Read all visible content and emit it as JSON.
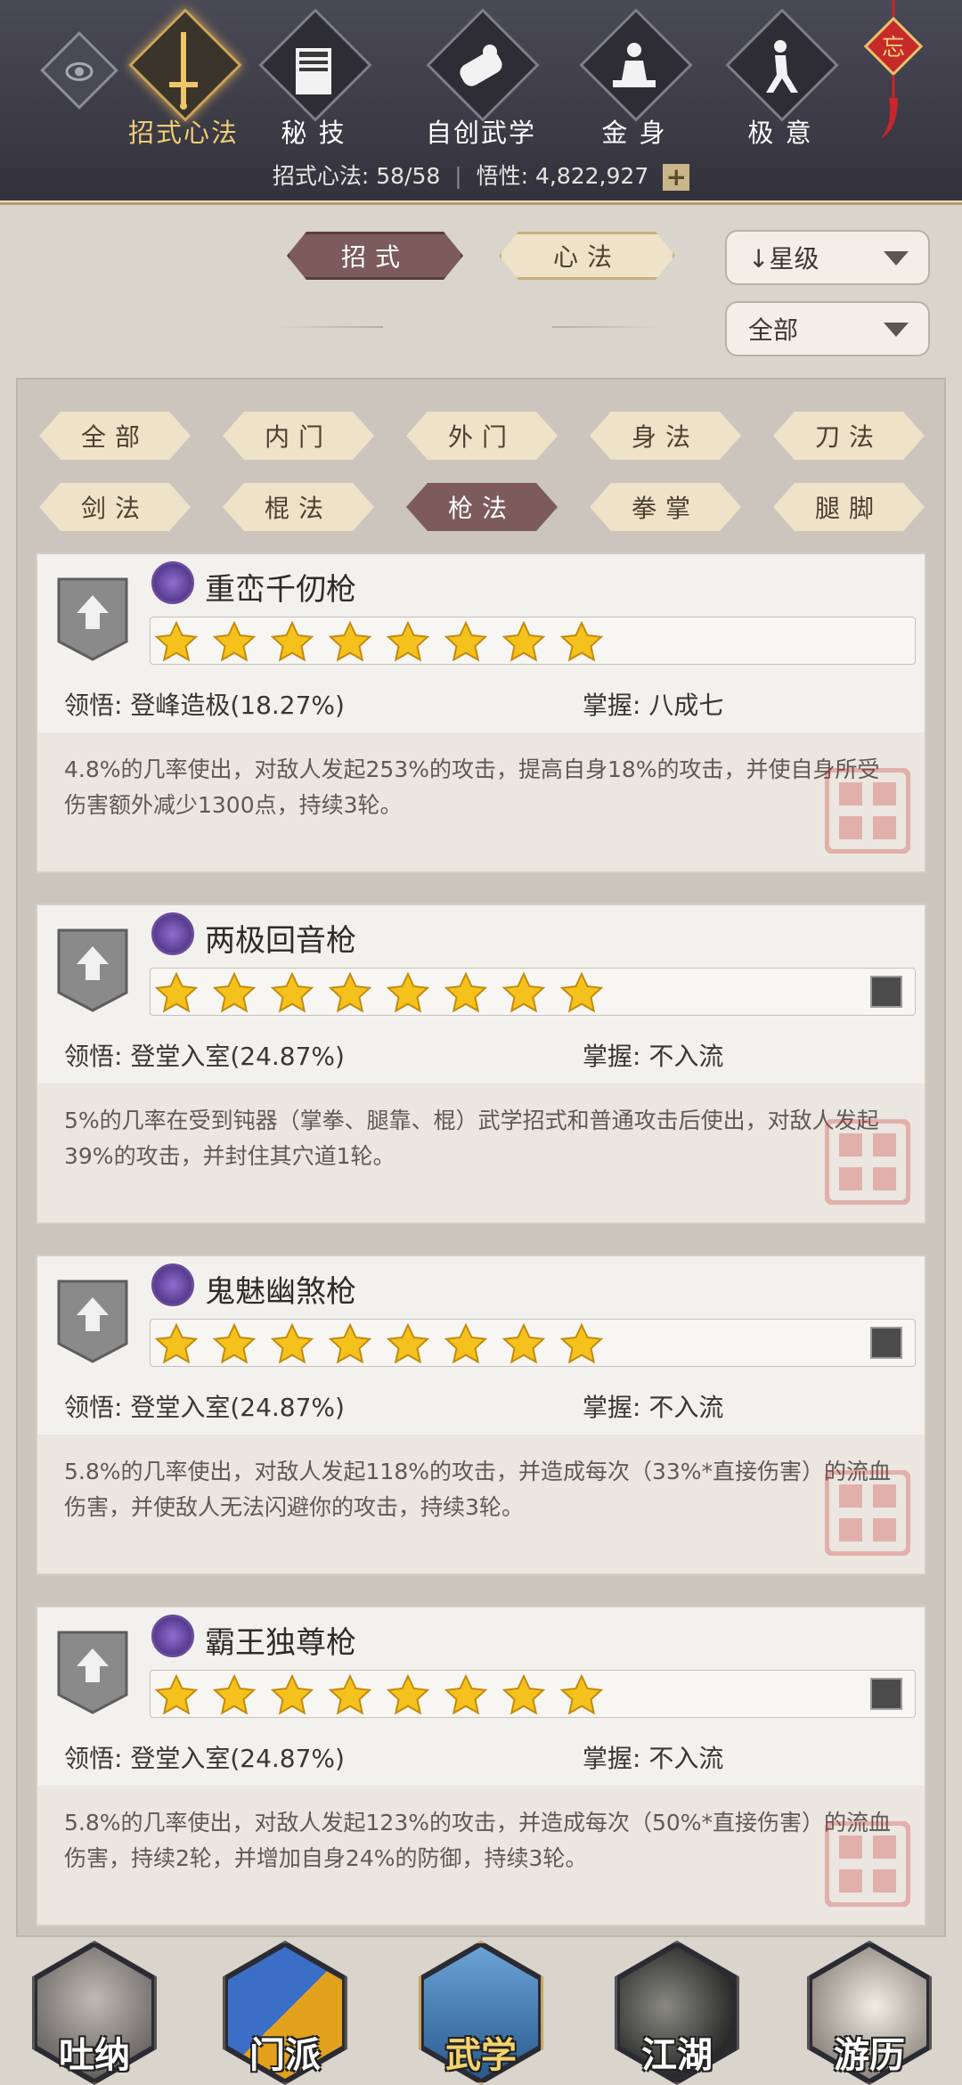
{
  "header": {
    "tabs": [
      {
        "label": "招式心法",
        "icon": "sword-icon",
        "active": true
      },
      {
        "label": "秘 技",
        "icon": "book-icon"
      },
      {
        "label": "自创武学",
        "icon": "scroll-icon"
      },
      {
        "label": "金 身",
        "icon": "meditation-icon"
      },
      {
        "label": "极 意",
        "icon": "martial-pose-icon"
      }
    ],
    "charm_text": "忘",
    "stats": {
      "label1": "招式心法:",
      "value1": "58/58",
      "label2": "悟性:",
      "value2": "4,822,927",
      "plus": "+"
    }
  },
  "filters": {
    "type_tabs": [
      {
        "label": "招式",
        "selected": true
      },
      {
        "label": "心法",
        "selected": false
      }
    ],
    "sort_dropdown": "↓星级",
    "range_dropdown": "全部"
  },
  "categories": [
    {
      "label": "全部"
    },
    {
      "label": "内门"
    },
    {
      "label": "外门"
    },
    {
      "label": "身法"
    },
    {
      "label": "刀法"
    },
    {
      "label": "剑法"
    },
    {
      "label": "棍法"
    },
    {
      "label": "枪法",
      "selected": true
    },
    {
      "label": "拳掌"
    },
    {
      "label": "腿脚"
    }
  ],
  "skills": [
    {
      "name": "重峦千仞枪",
      "stars": 8,
      "comprehension_label": "领悟:",
      "comprehension": "登峰造极(18.27%)",
      "mastery_label": "掌握:",
      "mastery": "八成七",
      "desc": "4.8%的几率使出，对敌人发起253%的攻击，提高自身18%的攻击，并使自身所受伤害额外减少1300点，持续3轮。",
      "badge": false
    },
    {
      "name": "两极回音枪",
      "stars": 8,
      "comprehension_label": "领悟:",
      "comprehension": "登堂入室(24.87%)",
      "mastery_label": "掌握:",
      "mastery": "不入流",
      "desc": "5%的几率在受到钝器（掌拳、腿靠、棍）武学招式和普通攻击后使出，对敌人发起39%的攻击，并封住其穴道1轮。",
      "badge": true
    },
    {
      "name": "鬼魅幽煞枪",
      "stars": 8,
      "comprehension_label": "领悟:",
      "comprehension": "登堂入室(24.87%)",
      "mastery_label": "掌握:",
      "mastery": "不入流",
      "desc": "5.8%的几率使出，对敌人发起118%的攻击，并造成每次（33%*直接伤害）的流血伤害，并使敌人无法闪避你的攻击，持续3轮。",
      "badge": true
    },
    {
      "name": "霸王独尊枪",
      "stars": 8,
      "comprehension_label": "领悟:",
      "comprehension": "登堂入室(24.87%)",
      "mastery_label": "掌握:",
      "mastery": "不入流",
      "desc": "5.8%的几率使出，对敌人发起123%的攻击，并造成每次（50%*直接伤害）的流血伤害，持续2轮，并增加自身24%的防御，持续3轮。",
      "badge": true
    }
  ],
  "bottom_nav": [
    {
      "label": "吐纳",
      "icon": "monk-silhouette-icon"
    },
    {
      "label": "门派",
      "icon": "sect-banner-icon"
    },
    {
      "label": "武学",
      "icon": "martial-book-icon",
      "active": true
    },
    {
      "label": "江湖",
      "icon": "hat-icon"
    },
    {
      "label": "游历",
      "icon": "horse-icon"
    }
  ]
}
